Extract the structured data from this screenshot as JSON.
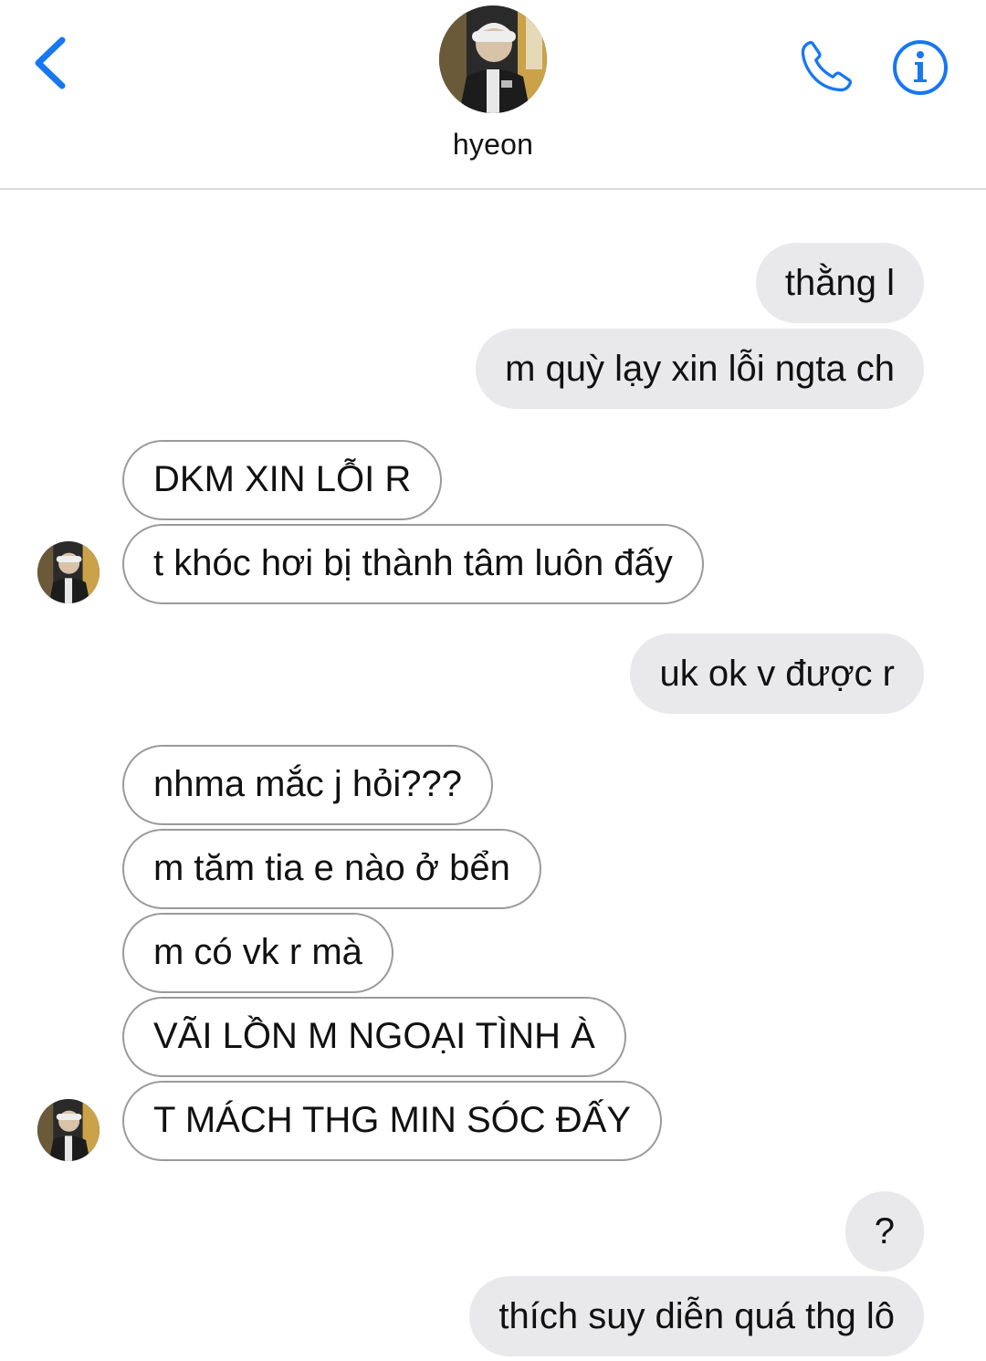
{
  "header": {
    "contact_name": "hyeon",
    "back_icon": "chevron-left-icon",
    "call_icon": "phone-icon",
    "info_icon": "info-icon",
    "accent_color": "#1877f2"
  },
  "messages": [
    {
      "side": "sent",
      "text": "thằng l"
    },
    {
      "side": "sent",
      "text": "m quỳ lạy xin lỗi ngta ch"
    },
    {
      "side": "received",
      "text": "DKM XIN LỖI R"
    },
    {
      "side": "received",
      "text": "t khóc hơi bị thành tâm luôn đấy"
    },
    {
      "side": "sent",
      "text": "uk ok v được r"
    },
    {
      "side": "received",
      "text": "nhma mắc j hỏi???"
    },
    {
      "side": "received",
      "text": "m tăm tia e nào ở bển"
    },
    {
      "side": "received",
      "text": "m có vk r mà"
    },
    {
      "side": "received",
      "text": "VÃI LỒN M NGOẠI TÌNH À"
    },
    {
      "side": "received",
      "text": "T MÁCH THG MIN SÓC ĐẤY"
    },
    {
      "side": "sent",
      "text": "?"
    },
    {
      "side": "sent",
      "text": "thích suy diễn quá thg lô"
    }
  ]
}
